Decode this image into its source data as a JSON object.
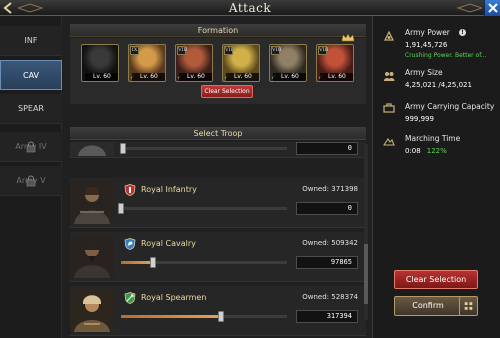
{
  "header": {
    "title": "Attack"
  },
  "sidebar": {
    "tabs": [
      {
        "label": "INF",
        "active": false,
        "locked": false
      },
      {
        "label": "CAV",
        "active": true,
        "locked": false
      },
      {
        "label": "SPEAR",
        "active": false,
        "locked": false
      },
      {
        "label": "Army IV",
        "active": false,
        "locked": true
      },
      {
        "label": "Army V",
        "active": false,
        "locked": true
      }
    ]
  },
  "formation": {
    "title": "Formation",
    "clear_label": "Clear Selection",
    "heroes": [
      {
        "level": "Lv. 60",
        "rank": "",
        "colors": [
          "#3a3a3a",
          "#111111"
        ]
      },
      {
        "level": "Lv. 60",
        "rank": "IX",
        "colors": [
          "#d39a4a",
          "#5a3a1e"
        ]
      },
      {
        "level": "Lv. 60",
        "rank": "VIII",
        "colors": [
          "#b15b3b",
          "#3a1f1a"
        ]
      },
      {
        "level": "Lv. 60",
        "rank": "VII",
        "colors": [
          "#d1b04a",
          "#5e4a1d"
        ]
      },
      {
        "level": "Lv. 60",
        "rank": "VIII",
        "colors": [
          "#8f7f64",
          "#2e2a22"
        ]
      },
      {
        "level": "Lv. 60",
        "rank": "VIII",
        "colors": [
          "#c2513a",
          "#4a1c16"
        ]
      }
    ]
  },
  "troops": {
    "title": "Select Troop",
    "partial_count": "0",
    "items": [
      {
        "name": "Royal Infantry",
        "owned": "Owned: 371398",
        "count": "0",
        "fill": 0.0
      },
      {
        "name": "Royal Cavalry",
        "owned": "Owned: 509342",
        "count": "97865",
        "fill": 0.19
      },
      {
        "name": "Royal Spearmen",
        "owned": "Owned: 528374",
        "count": "317394",
        "fill": 0.6
      }
    ]
  },
  "stats": {
    "army_power_label": "Army Power",
    "army_power_value": "1,91,45,726",
    "army_power_sub": "Crushing Power. Better of...",
    "army_size_label": "Army Size",
    "army_size_value": "4,25,021 /4,25,021",
    "carrying_label": "Army Carrying Capacity",
    "carrying_value": "999,999",
    "marching_label": "Marching Time",
    "marching_value": "0:08",
    "marching_pct": "122%"
  },
  "actions": {
    "clear_label": "Clear Selection",
    "confirm_label": "Confirm"
  },
  "colors": {
    "accent_gold": "#e9d9b0",
    "active_tab": "#3b5779",
    "danger": "#b7332f",
    "green": "#5bd45b"
  }
}
